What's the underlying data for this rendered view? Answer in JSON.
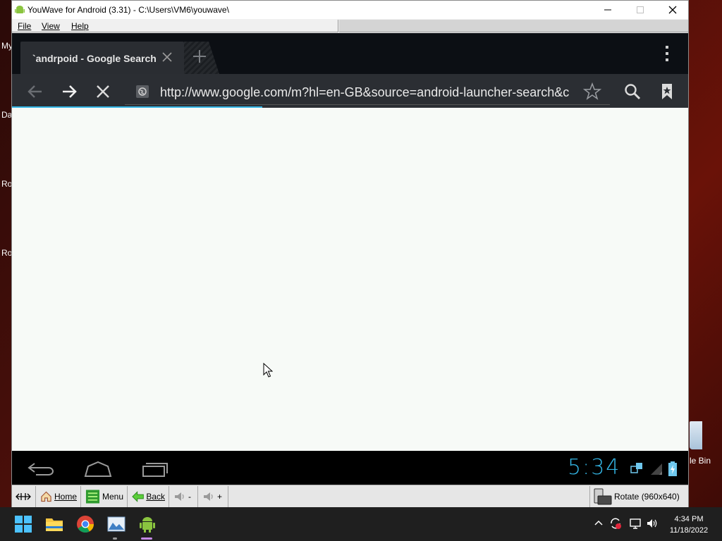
{
  "desktop": {
    "icon_labels": [
      "My",
      "Da",
      "Ro",
      "Ro"
    ],
    "recycle_label": "le Bin"
  },
  "window": {
    "title": "YouWave for Android (3.31) - C:\\Users\\VM6\\youwave\\",
    "menu": [
      "File",
      "View",
      "Help"
    ]
  },
  "browser": {
    "tab_title": "`andrpoid - Google Search",
    "url": "http://www.google.com/m?hl=en-GB&source=android-launcher-search&c",
    "progress_fraction": 0.37
  },
  "status": {
    "clock": "5:34"
  },
  "youwave_bar": {
    "home": "Home",
    "menu": "Menu",
    "back": "Back",
    "vol_down": "-",
    "vol_up": "+",
    "rotate": "Rotate (960x640)"
  },
  "taskbar": {
    "time": "4:34 PM",
    "date": "11/18/2022"
  },
  "colors": {
    "accent": "#33b5e5",
    "toolbar": "#2b2e33",
    "taskbar": "#1f1f1f"
  }
}
